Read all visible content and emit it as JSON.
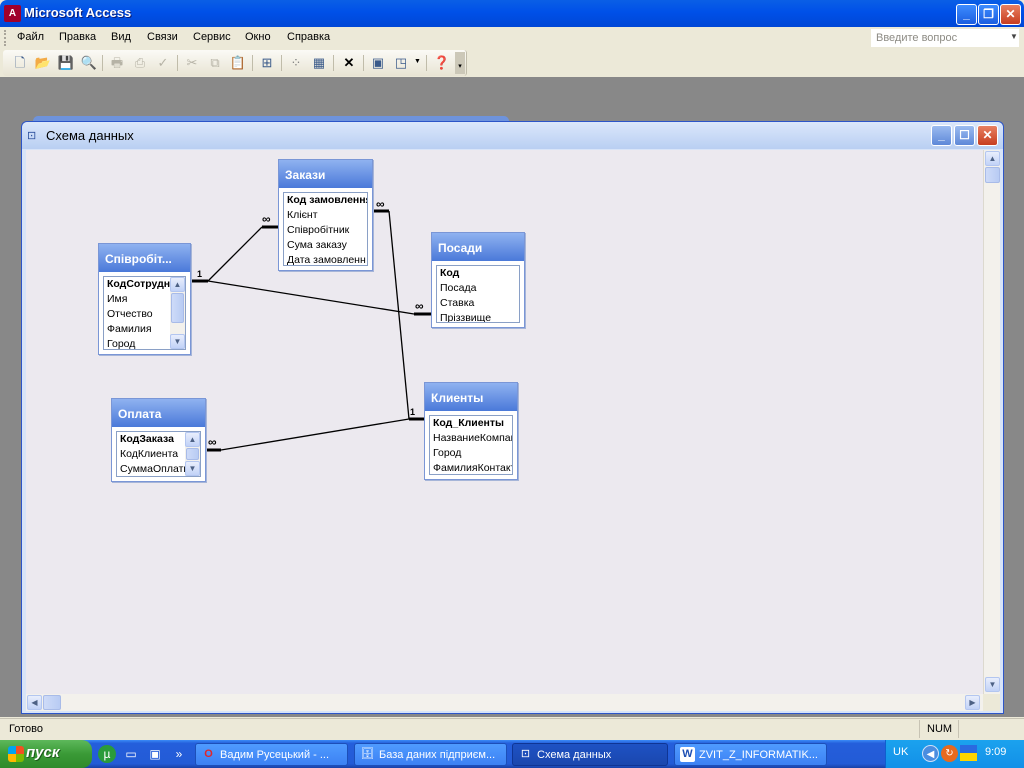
{
  "app": {
    "title": "Microsoft Access"
  },
  "menu": [
    "Файл",
    "Правка",
    "Вид",
    "Связи",
    "Сервис",
    "Окно",
    "Справка"
  ],
  "help_placeholder": "Введите вопрос",
  "window": {
    "title": "Схема данных"
  },
  "tables": [
    {
      "id": "spivrob",
      "title": "Співробіт...",
      "fields": [
        "КодСотрудн",
        "Имя",
        "Отчество",
        "Фамилия",
        "Город"
      ],
      "scrollable": true
    },
    {
      "id": "zakazy",
      "title": "Закази",
      "fields": [
        "Код замовлення",
        "Клієнт",
        "Співробітник",
        "Сума заказу",
        "Дата замовленн"
      ],
      "scrollable": false
    },
    {
      "id": "posady",
      "title": "Посади",
      "fields": [
        "Код",
        "Посада",
        "Ставка",
        "Пріззвище"
      ],
      "scrollable": false
    },
    {
      "id": "oplata",
      "title": "Оплата",
      "fields": [
        "КодЗаказа",
        "КодКлиента",
        "СуммаОплаты"
      ],
      "scrollable": true
    },
    {
      "id": "klienty",
      "title": "Клиенты",
      "fields": [
        "Код_Клиенты",
        "НазваниеКомпан",
        "Город",
        "ФамилияКонтакт"
      ],
      "scrollable": false
    }
  ],
  "relations": [
    {
      "from": "Співробіт...",
      "to": "Закази",
      "one": "1",
      "many": "∞"
    },
    {
      "from": "Співробіт...",
      "to": "Посади",
      "one": "1",
      "many": "∞"
    },
    {
      "from": "Клиенты",
      "to": "Закази",
      "one": "1",
      "many": "∞"
    },
    {
      "from": "Клиенты",
      "to": "Оплата",
      "one": "1",
      "many": "∞"
    }
  ],
  "status": {
    "text": "Готово",
    "num": "NUM"
  },
  "taskbar": {
    "start": "пуск",
    "tasks": [
      "Вадим Русецький - ...",
      "База даних підприєм...",
      "Схема данных",
      "ZVIT_Z_INFORMATIK..."
    ],
    "lang": "UK",
    "clock": "9:09"
  }
}
